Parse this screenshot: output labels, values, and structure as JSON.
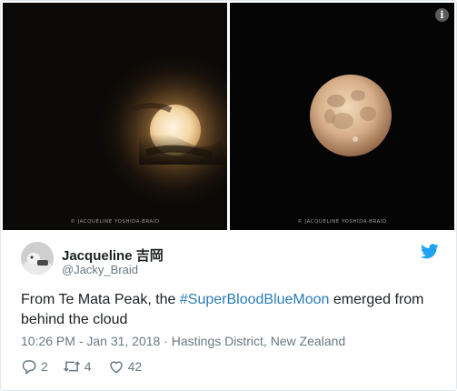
{
  "media": {
    "left_photo_credit": "© JACQUELINE YOSHIDA-BRAID",
    "right_photo_credit": "© JACQUELINE YOSHIDA-BRAID",
    "info_icon": "i"
  },
  "author": {
    "display_name": "Jacqueline 吉岡",
    "handle": "@Jacky_Braid",
    "avatar_icon": "avatar-photo"
  },
  "brand": {
    "icon": "twitter-bird-icon",
    "color": "#1da1f2"
  },
  "tweet": {
    "text_before": "From Te Mata Peak, the ",
    "hashtag": "#SuperBloodBlueMoon",
    "text_after": " emerged from behind the cloud",
    "hashtag_color": "#2b7bb9"
  },
  "meta": {
    "time": "10:26 PM - Jan 31, 2018",
    "separator": " · ",
    "location": "Hastings District, New Zealand"
  },
  "actions": {
    "reply_count": "2",
    "retweet_count": "4",
    "like_count": "42"
  }
}
